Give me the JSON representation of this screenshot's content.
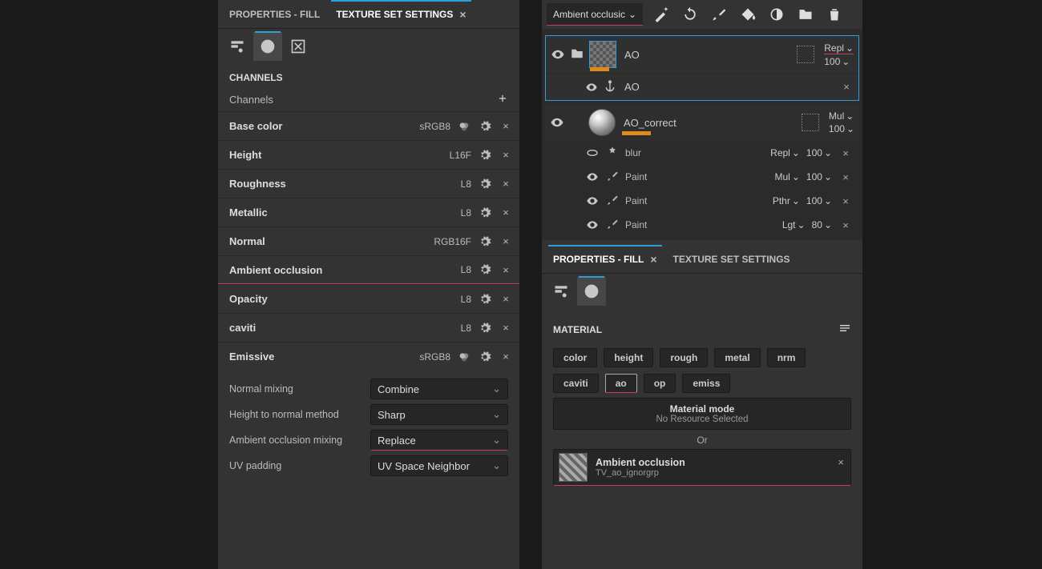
{
  "left_panel": {
    "tabs": [
      {
        "label": "PROPERTIES - FILL",
        "active": false,
        "closable": false
      },
      {
        "label": "TEXTURE SET SETTINGS",
        "active": true,
        "closable": true
      }
    ],
    "channels_header": "CHANNELS",
    "channels_label": "Channels",
    "channels": [
      {
        "name": "Base color",
        "format": "sRGB8",
        "show_mix": true
      },
      {
        "name": "Height",
        "format": "L16F",
        "show_mix": false
      },
      {
        "name": "Roughness",
        "format": "L8",
        "show_mix": false
      },
      {
        "name": "Metallic",
        "format": "L8",
        "show_mix": false
      },
      {
        "name": "Normal",
        "format": "RGB16F",
        "show_mix": false
      },
      {
        "name": "Ambient occlusion",
        "format": "L8",
        "show_mix": false,
        "underline": true
      },
      {
        "name": "Opacity",
        "format": "L8",
        "show_mix": false
      },
      {
        "name": "caviti",
        "format": "L8",
        "show_mix": false
      },
      {
        "name": "Emissive",
        "format": "sRGB8",
        "show_mix": true
      }
    ],
    "settings": [
      {
        "label": "Normal mixing",
        "value": "Combine"
      },
      {
        "label": "Height to normal method",
        "value": "Sharp"
      },
      {
        "label": "Ambient occlusion mixing",
        "value": "Replace",
        "underline": true
      },
      {
        "label": "UV padding",
        "value": "UV Space Neighbor"
      }
    ]
  },
  "right_panel": {
    "toolbar": {
      "channel_dropdown": "Ambient occlusic"
    },
    "layers": {
      "group": {
        "name": "AO",
        "blend": "Repl",
        "opacity": "100",
        "sublayer": {
          "name": "AO"
        }
      },
      "group2": {
        "name": "AO_correct",
        "blend": "Mul",
        "opacity": "100",
        "sublayers": [
          {
            "name": "blur",
            "blend": "Repl",
            "opacity": "100",
            "icon": "effect"
          },
          {
            "name": "Paint",
            "blend": "Mul",
            "opacity": "100",
            "icon": "brush"
          },
          {
            "name": "Paint",
            "blend": "Pthr",
            "opacity": "100",
            "icon": "brush"
          },
          {
            "name": "Paint",
            "blend": "Lgt",
            "opacity": "80",
            "icon": "brush"
          }
        ]
      }
    },
    "tabs": [
      {
        "label": "PROPERTIES - FILL",
        "active": true,
        "closable": true
      },
      {
        "label": "TEXTURE SET SETTINGS",
        "active": false,
        "closable": false
      }
    ],
    "material": {
      "header": "MATERIAL",
      "buttons": [
        "color",
        "height",
        "rough",
        "metal",
        "nrm",
        "caviti",
        "ao",
        "op",
        "emiss"
      ],
      "selected": "ao",
      "mode_title": "Material mode",
      "mode_sub": "No Resource Selected",
      "or": "Or",
      "resource": {
        "title": "Ambient occlusion",
        "subtitle": "TV_ao_ignorgrp"
      }
    }
  }
}
